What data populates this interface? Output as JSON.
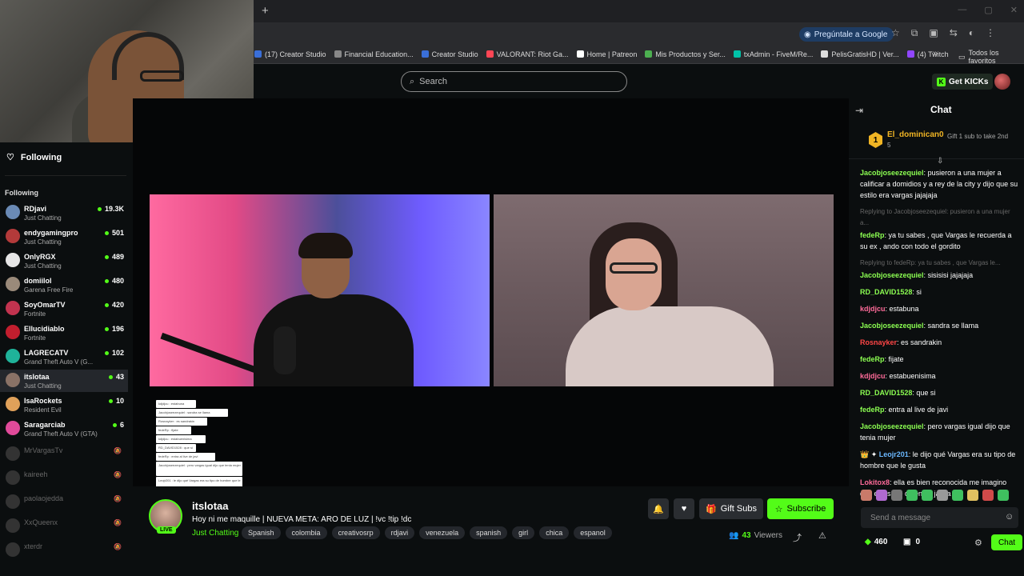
{
  "browser": {
    "new_tab": "+",
    "ask_google": "Pregúntale a Google",
    "bookmarks": [
      "(17) Creator Studio",
      "Financial Education...",
      "Creator Studio",
      "VALORANT: Riot Ga...",
      "Home | Patreon",
      "Mis Productos y Ser...",
      "txAdmin - FiveM/Re...",
      "PelisGratisHD | Ver...",
      "(4) Twitch"
    ],
    "more": "»",
    "folder": "Todos los favoritos"
  },
  "header": {
    "search_placeholder": "Search",
    "get_kicks": "Get KICKs"
  },
  "sidebar": {
    "following_title": "Following",
    "following_sub": "Following",
    "channels": [
      {
        "name": "RDjavi",
        "category": "Just Chatting",
        "viewers": "19.3K"
      },
      {
        "name": "endygamingpro",
        "category": "Just Chatting",
        "viewers": "501"
      },
      {
        "name": "OnlyRGX",
        "category": "Just Chatting",
        "viewers": "489"
      },
      {
        "name": "domiilol",
        "category": "Garena Free Fire",
        "viewers": "480"
      },
      {
        "name": "SoyOmarTV",
        "category": "Fortnite",
        "viewers": "420"
      },
      {
        "name": "Ellucidiablo",
        "category": "Fortnite",
        "viewers": "196"
      },
      {
        "name": "LAGRECATV",
        "category": "Grand Theft Auto V (G...",
        "viewers": "102"
      },
      {
        "name": "itslotaa",
        "category": "Just Chatting",
        "viewers": "43"
      },
      {
        "name": "IsaRockets",
        "category": "Resident Evil",
        "viewers": "10"
      },
      {
        "name": "Saragarciab",
        "category": "Grand Theft Auto V (GTA)",
        "viewers": "6"
      }
    ],
    "offline": [
      "MrVargasTv",
      "kaireeh",
      "paolaojedda",
      "XxQueenx",
      "xterdr"
    ]
  },
  "overlay_chat": [
    "kdjdjcu : estabuna",
    "Jacobjoseezequiel : sandra se llama",
    "Rosnayker : es sandrakin",
    "fedeRp : fijate",
    "kdjdjcu : estabuenisima",
    "RD_DAVID1528 : que si",
    "fedeRp : entra al live de javi",
    "Jacobjoseezequiel : pero vargas igual dijo que tenia mujer",
    "Leojr201 : le dijo qué Vargas era su tipo de hombre que le gusta"
  ],
  "stream": {
    "streamer": "itslotaa",
    "live": "LIVE",
    "title": "Hoy ni me maquille | NUEVA META: ARO DE LUZ | !vc !tip !dc",
    "category": "Just Chatting",
    "tags": [
      "Spanish",
      "colombia",
      "creativosrp",
      "rdjavi",
      "venezuela",
      "spanish",
      "girl",
      "chica",
      "espanol"
    ],
    "gift_subs": "Gift Subs",
    "subscribe": "Subscribe",
    "viewers": "43",
    "viewers_label": "Viewers"
  },
  "chat": {
    "title": "Chat",
    "pinned": {
      "rank": "1",
      "user": "El_dominican0",
      "count": "5",
      "gift_text": "Gift 1 sub to take 2nd"
    },
    "messages": [
      {
        "type": "msg",
        "user": "Jacobjoseezequiel",
        "color": "#8cff52",
        "text": "pusieron a una mujer a calificar a domidios y a rey de la city y dijo que su estilo era vargas jajajaja"
      },
      {
        "type": "reply",
        "text": "Replying to Jacobjoseezequiel: pusieron a una mujer a..."
      },
      {
        "type": "msg",
        "user": "fedeRp",
        "color": "#8cff52",
        "text": "ya tu sabes , que Vargas le recuerda a su ex , ando con todo el gordito"
      },
      {
        "type": "reply",
        "text": "Replying to fedeRp: ya tu sabes , que Vargas le..."
      },
      {
        "type": "msg",
        "user": "Jacobjoseezequiel",
        "color": "#8cff52",
        "text": "sisisisi jajajaja"
      },
      {
        "type": "msg",
        "user": "RD_DAVID1528",
        "color": "#8cff52",
        "text": "si"
      },
      {
        "type": "msg",
        "user": "kdjdjcu",
        "color": "#ff6b9a",
        "text": "estabuna"
      },
      {
        "type": "msg",
        "user": "Jacobjoseezequiel",
        "color": "#8cff52",
        "text": "sandra se llama"
      },
      {
        "type": "msg",
        "user": "Rosnayker",
        "color": "#ff4646",
        "text": "es sandrakin"
      },
      {
        "type": "msg",
        "user": "fedeRp",
        "color": "#8cff52",
        "text": "fijate"
      },
      {
        "type": "msg",
        "user": "kdjdjcu",
        "color": "#ff6b9a",
        "text": "estabuenisima"
      },
      {
        "type": "msg",
        "user": "RD_DAVID1528",
        "color": "#8cff52",
        "text": "que si"
      },
      {
        "type": "msg",
        "user": "fedeRp",
        "color": "#8cff52",
        "text": "entra al live de javi"
      },
      {
        "type": "msg",
        "user": "Jacobjoseezequiel",
        "color": "#8cff52",
        "text": "pero vargas igual dijo que tenia mujer"
      },
      {
        "type": "msg",
        "user": "Leojr201",
        "color": "#6bb8ff",
        "badges": "👑 ✦ ",
        "text": "le dijo qué Vargas era su tipo de hombre que le gusta"
      },
      {
        "type": "msg",
        "user": "Lokitox8",
        "color": "#ff6b9a",
        "text": "ella es bien reconocida me imagino que ella sabe quien es jajaja"
      }
    ],
    "input_placeholder": "Send a message",
    "points": "460",
    "boxes": "0",
    "send": "Chat"
  }
}
